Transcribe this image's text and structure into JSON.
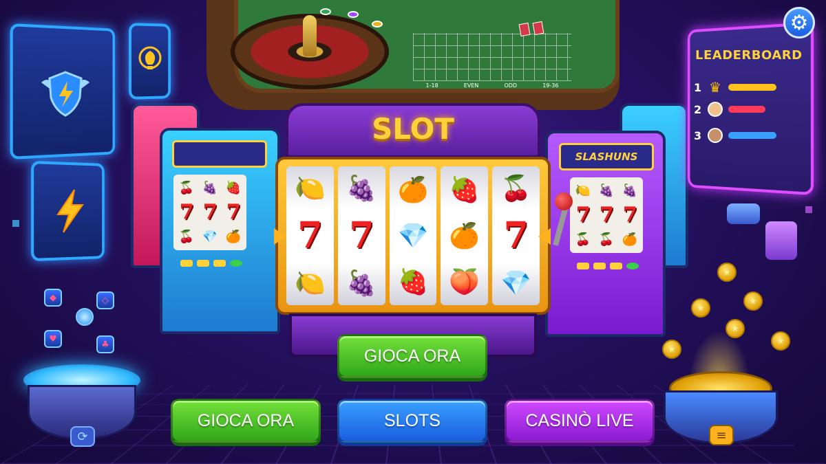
{
  "screen": {
    "machine_title": "SLOT",
    "side_machine_sign": "SLASHUNS",
    "table_labels": [
      "1-18",
      "EVEN",
      "ODD",
      "19-36"
    ]
  },
  "leaderboard": {
    "title": "LEADERBOARD",
    "rows": [
      {
        "rank": "1",
        "bar_color": "#ffc21e",
        "bar_fill": 0.8
      },
      {
        "rank": "2",
        "bar_color": "#ff3a5a",
        "bar_fill": 0.6
      },
      {
        "rank": "3",
        "bar_color": "#3aa0ff",
        "bar_fill": 0.8
      }
    ]
  },
  "reels": [
    [
      "🍋",
      "7",
      "🍋"
    ],
    [
      "🍇",
      "7",
      "🍇"
    ],
    [
      "🍊",
      "💎",
      "🍓"
    ],
    [
      "🍓",
      "🍊",
      "🍑"
    ],
    [
      "🍒",
      "7",
      "💎"
    ]
  ],
  "left_side_reels": [
    [
      "🍒",
      "7",
      "🍒"
    ],
    [
      "🍇",
      "7",
      "💎"
    ],
    [
      "🍓",
      "7",
      "🍊"
    ]
  ],
  "right_side_reels": [
    [
      "🍋",
      "7",
      "🍒"
    ],
    [
      "🍇",
      "7",
      "🍒"
    ],
    [
      "🍇",
      "7",
      "🍊"
    ]
  ],
  "buttons": {
    "play_now_center": "GIOCA ORA",
    "play_now": "GIOCA ORA",
    "slots": "SLOTS",
    "live_casino": "CASINÒ LIVE"
  },
  "icons": {
    "settings": "gear-icon",
    "shield": "winged-shield-lightning-icon",
    "bulb": "lightbulb-icon",
    "bolt": "lightning-icon",
    "refresh": "refresh-icon",
    "menu": "menu-icon"
  },
  "colors": {
    "green_button": "#2fa81a",
    "blue_button": "#1a5ee0",
    "purple_button": "#8a1ad0",
    "gold": "#ffd23c",
    "background": "#24105e"
  }
}
